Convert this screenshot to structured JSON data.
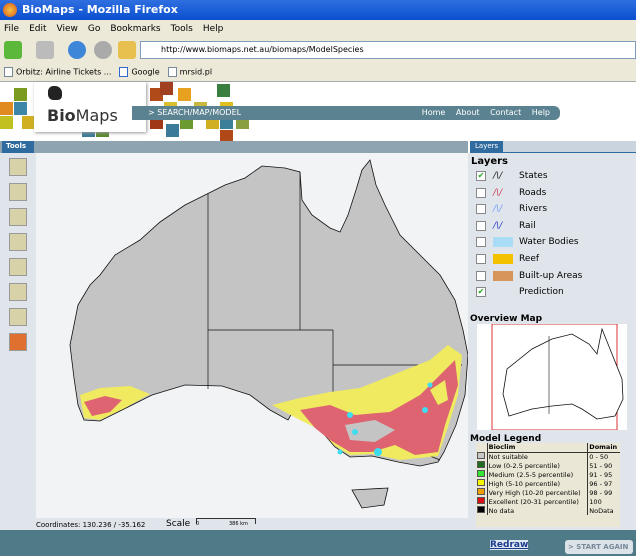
{
  "window": {
    "title": "BioMaps - Mozilla Firefox"
  },
  "menu": [
    "File",
    "Edit",
    "View",
    "Go",
    "Bookmarks",
    "Tools",
    "Help"
  ],
  "url": "http://www.biomaps.net.au/biomaps/ModelSpecies",
  "bookmarks": [
    "Orbitz: Airline Tickets ...",
    "Google",
    "mrsid.pl"
  ],
  "site": {
    "logo_bold": "Bio",
    "logo_light": "Maps",
    "section": "> SEARCH/MAP/MODEL",
    "nav": [
      "Home",
      "About",
      "Contact",
      "Help"
    ]
  },
  "tabs": {
    "tools": "Tools",
    "layers": "Layers"
  },
  "tools": [
    "zoom-in",
    "zoom-out",
    "pan",
    "identify",
    "query",
    "measure",
    "clear",
    "full-extent"
  ],
  "status": {
    "coordinates": "Coordinates: 130.236 / -35.162",
    "scale_label": "Scale",
    "scale_min": "0",
    "scale_max": "386 km"
  },
  "layers": {
    "heading": "Layers",
    "items": [
      {
        "label": "States",
        "checked": true,
        "color": "#222222"
      },
      {
        "label": "Roads",
        "checked": false,
        "color": "#d0405a"
      },
      {
        "label": "Rivers",
        "checked": false,
        "color": "#6fa0ff"
      },
      {
        "label": "Rail",
        "checked": false,
        "color": "#2a3cd0"
      },
      {
        "label": "Water Bodies",
        "checked": false,
        "color": "#a9dcf5"
      },
      {
        "label": "Reef",
        "checked": false,
        "color": "#f2c200"
      },
      {
        "label": "Built-up Areas",
        "checked": false,
        "color": "#d8955a"
      },
      {
        "label": "Prediction",
        "checked": true,
        "color": ""
      }
    ]
  },
  "overview": {
    "heading": "Overview Map"
  },
  "legend": {
    "heading": "Model Legend",
    "col1": "Bioclim",
    "col2": "Domain",
    "rows": [
      {
        "label": "Not suitable",
        "domain": "0 - 50",
        "color": "#c8c8c8"
      },
      {
        "label": "Low (0-2.5 percentile)",
        "domain": "51 - 90",
        "color": "#1f6b1f"
      },
      {
        "label": "Medium (2.5-5 percentile)",
        "domain": "91 - 95",
        "color": "#33e633"
      },
      {
        "label": "High (5-10 percentile)",
        "domain": "96 - 97",
        "color": "#f5f500"
      },
      {
        "label": "Very High (10-20 percentile)",
        "domain": "98 - 99",
        "color": "#f0a000"
      },
      {
        "label": "Excellent (20-31 percentile)",
        "domain": "100",
        "color": "#dd1010"
      },
      {
        "label": "No data",
        "domain": "NoData",
        "color": "#000000"
      }
    ]
  },
  "buttons": {
    "redraw": "Redraw",
    "start_again": "> START AGAIN"
  }
}
